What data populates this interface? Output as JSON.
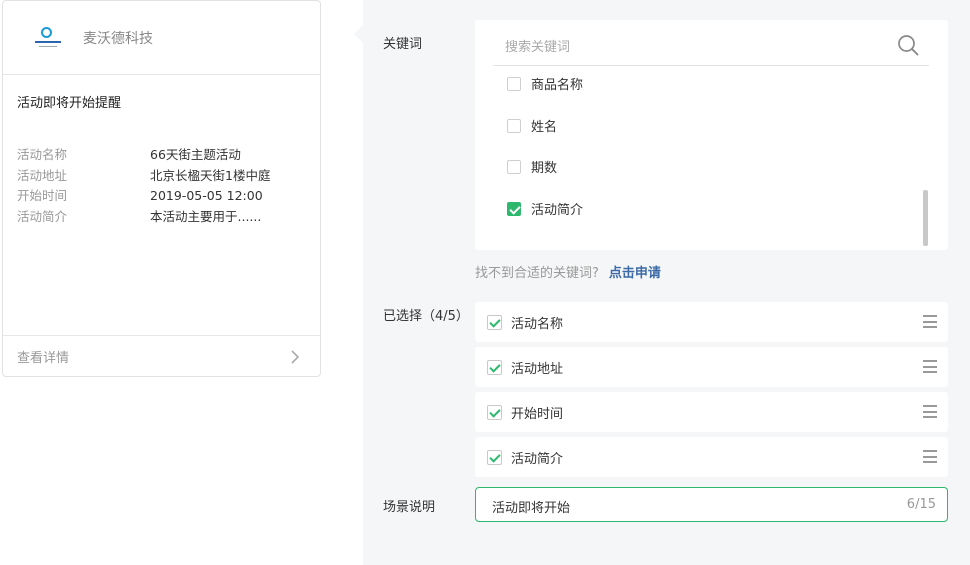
{
  "card": {
    "brand": "麦沃德科技",
    "title": "活动即将开始提醒",
    "rows": [
      {
        "label": "活动名称",
        "value": "66天街主题活动"
      },
      {
        "label": "活动地址",
        "value": "北京长楹天街1楼中庭"
      },
      {
        "label": "开始时间",
        "value": "2019-05-05 12:00"
      },
      {
        "label": "活动简介",
        "value": "本活动主要用于......"
      }
    ],
    "footer_link": "查看详情"
  },
  "panel": {
    "keyword_label": "关键词",
    "search_placeholder": "搜索关键词",
    "options": [
      {
        "label": "商品名称",
        "checked": false
      },
      {
        "label": "姓名",
        "checked": false
      },
      {
        "label": "期数",
        "checked": false
      },
      {
        "label": "活动简介",
        "checked": true
      }
    ],
    "hint_text": "找不到合适的关键词?",
    "hint_link": "点击申请",
    "selected_label": "已选择（4/5）",
    "selected": [
      {
        "label": "活动名称"
      },
      {
        "label": "活动地址"
      },
      {
        "label": "开始时间"
      },
      {
        "label": "活动简介"
      }
    ],
    "scene_label": "场景说明",
    "scene_value": "活动即将开始",
    "scene_count": "6/15"
  },
  "colors": {
    "accent": "#2db86e",
    "link": "#3d6aa8",
    "panel_bg": "#f4f6f7"
  }
}
